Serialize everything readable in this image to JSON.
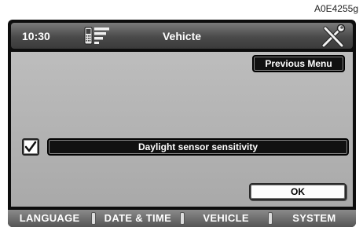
{
  "figure_id": "A0E4255g",
  "header": {
    "time": "10:30",
    "title": "Vehicte",
    "phone_icon": "phone-signal-icon",
    "tools_icon": "tools-icon"
  },
  "content": {
    "previous_menu_label": "Previous Menu",
    "setting_label": "Daylight sensor sensitivity",
    "setting_checked": true,
    "ok_label": "OK"
  },
  "tabs": [
    {
      "label": "LANGUAGE"
    },
    {
      "label": "DATE & TIME"
    },
    {
      "label": "VEHICLE",
      "active": true
    },
    {
      "label": "SYSTEM"
    }
  ]
}
